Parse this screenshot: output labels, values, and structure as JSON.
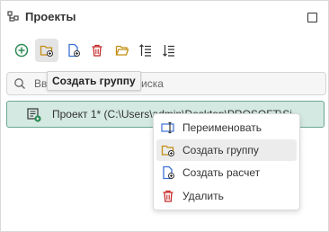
{
  "panel": {
    "title": "Проекты"
  },
  "toolbar": {
    "buttons": [
      {
        "name": "add-button"
      },
      {
        "name": "create-group-button"
      },
      {
        "name": "create-calculation-button"
      },
      {
        "name": "delete-button"
      },
      {
        "name": "open-folder-button"
      },
      {
        "name": "sort-ascending-button"
      },
      {
        "name": "sort-descending-button"
      }
    ],
    "tooltip": "Создать группу"
  },
  "search": {
    "visible_text": "В",
    "placeholder": "Введите текст для поиска",
    "visible_tail": "поиска"
  },
  "tree": {
    "project_label": "Проект 1* (C:\\Users\\admin\\Desktop\\PROSOFT\\Si..."
  },
  "context_menu": {
    "items": [
      {
        "label": "Переименовать",
        "icon": "rename-icon"
      },
      {
        "label": "Создать группу",
        "icon": "folder-add-icon",
        "highlighted": true
      },
      {
        "label": "Создать расчет",
        "icon": "file-add-icon"
      },
      {
        "label": "Удалить",
        "icon": "trash-icon"
      }
    ]
  },
  "colors": {
    "accent_green": "#2e8b57",
    "selection_bg": "#d4e9e1",
    "selection_border": "#6aa892",
    "folder_yellow": "#e0a526",
    "delete_red": "#c62828",
    "doc_blue": "#3b6fd4"
  }
}
